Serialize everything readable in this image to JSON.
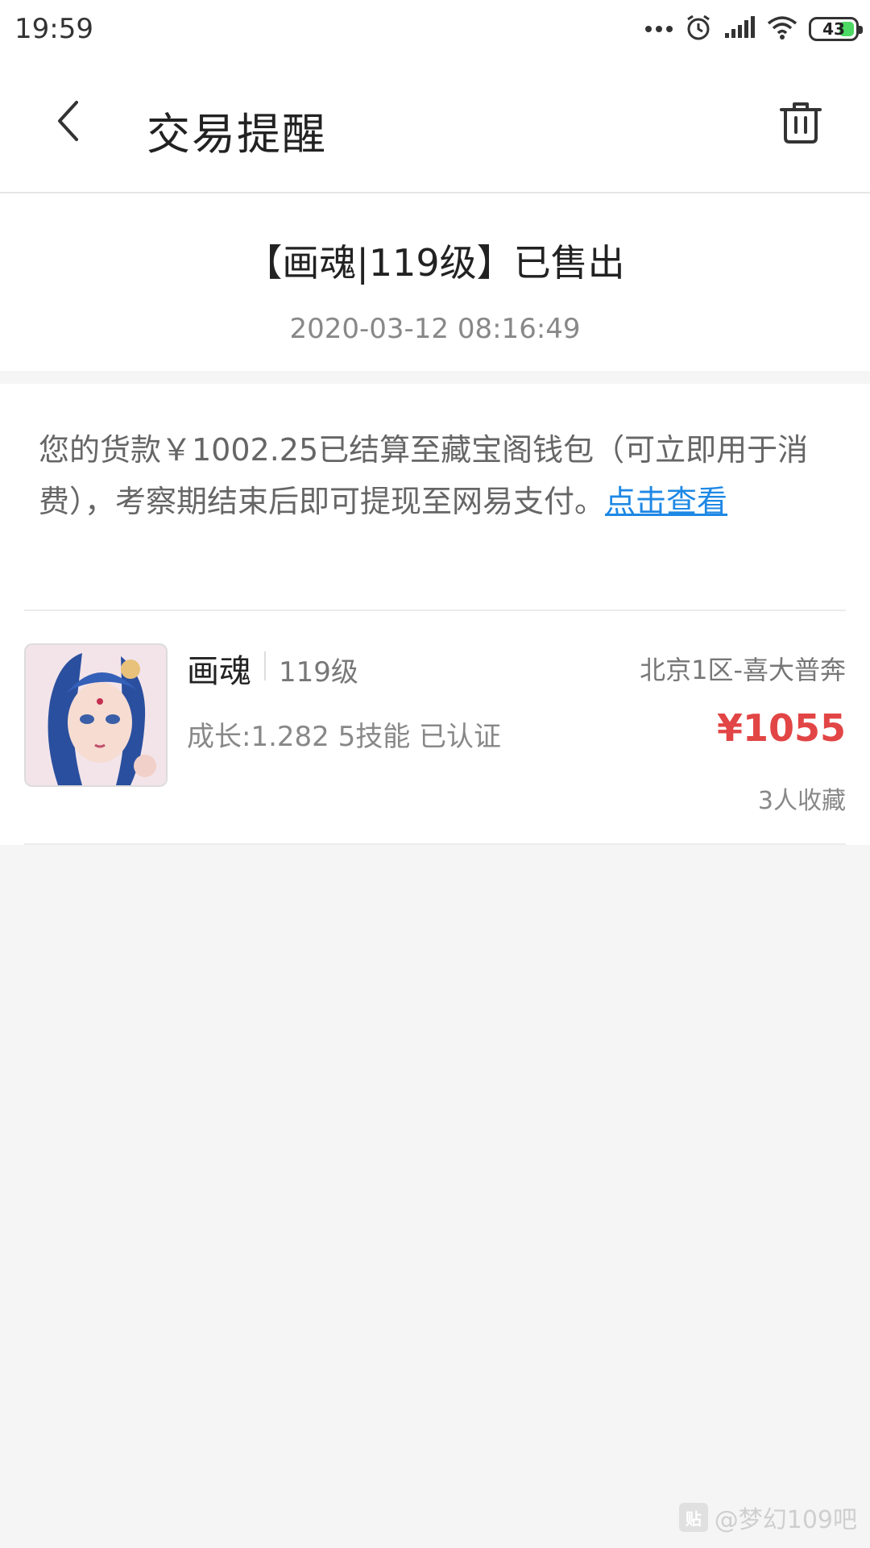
{
  "status_bar": {
    "time": "19:59",
    "battery": "43"
  },
  "nav": {
    "title": "交易提醒"
  },
  "message": {
    "title": "【画魂|119级】已售出",
    "time": "2020-03-12 08:16:49",
    "content": "您的货款￥1002.25已结算至藏宝阁钱包（可立即用于消费），考察期结束后即可提现至网易支付。",
    "link_text": "点击查看"
  },
  "item": {
    "name": "画魂",
    "level": "119级",
    "server": "北京1区-喜大普奔",
    "attributes": "成长:1.282 5技能 已认证",
    "price": "¥1055",
    "favorites": "3人收藏"
  },
  "watermark": {
    "text": "@梦幻109吧"
  },
  "colors": {
    "link": "#1e88e5",
    "price": "#e24545"
  }
}
